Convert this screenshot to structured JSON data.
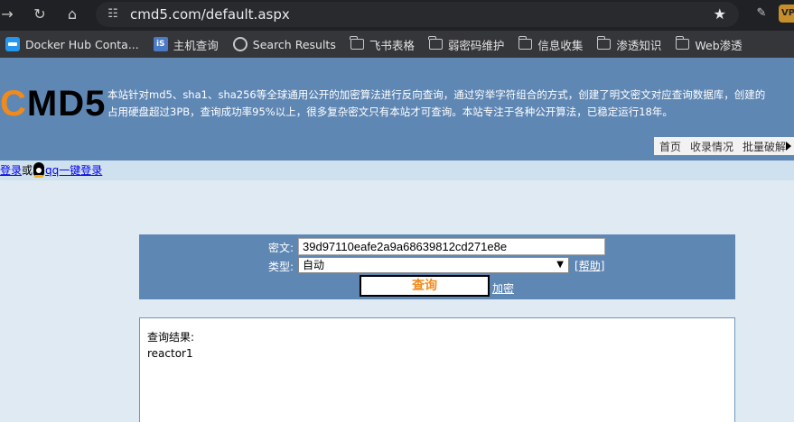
{
  "browser": {
    "url": "cmd5.com/default.aspx",
    "bookmarks": [
      {
        "label": "Docker Hub Conta...",
        "icon": "docker-icon"
      },
      {
        "label": "主机查询",
        "icon": "is-icon"
      },
      {
        "label": "Search Results",
        "icon": "globe-icon"
      },
      {
        "label": "飞书表格",
        "icon": "folder-icon"
      },
      {
        "label": "弱密码维护",
        "icon": "folder-icon"
      },
      {
        "label": "信息收集",
        "icon": "folder-icon"
      },
      {
        "label": "渗透知识",
        "icon": "folder-icon"
      },
      {
        "label": "Web渗透",
        "icon": "folder-icon"
      }
    ]
  },
  "header": {
    "logo_c": "C",
    "logo_rest": "MD5",
    "intro_line1": "本站针对md5、sha1、sha256等全球通用公开的加密算法进行反向查询，通过穷举字符组合的方式，创建了明文密文对应查询数据库，创建的",
    "intro_line2": "占用硬盘超过3PB，查询成功率95%以上，很多复杂密文只有本站才可查询。本站专注于各种公开算法，已稳定运行18年。",
    "nav": [
      "首页",
      "收录情况",
      "批量破解"
    ]
  },
  "login": {
    "login_link": "登录",
    "or_text": "或",
    "qq_link": "qq一键登录"
  },
  "query": {
    "cipher_label": "密文:",
    "cipher_value": "39d97110eafe2a9a68639812cd271e8e",
    "type_label": "类型:",
    "type_value": "自动",
    "help_open": "[",
    "help_link": "帮助",
    "help_close": "]",
    "query_button": "查询",
    "encrypt_link": "加密"
  },
  "result": {
    "label": "查询结果:",
    "value": "reactor1"
  }
}
